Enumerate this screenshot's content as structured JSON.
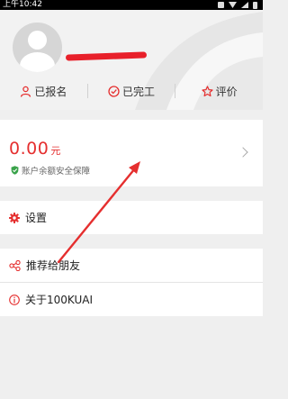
{
  "status_bar": {
    "time": "上午10:42"
  },
  "profile": {
    "avatar_icon": "default-avatar-icon"
  },
  "order_tabs": [
    {
      "label": "已报名",
      "icon": "person-icon"
    },
    {
      "label": "已完工",
      "icon": "check-circle-icon"
    },
    {
      "label": "评价",
      "icon": "star-icon"
    }
  ],
  "balance": {
    "amount": "0.00",
    "unit": "元",
    "safety_text": "账户余额安全保障",
    "safety_icon": "shield-check-icon"
  },
  "menu": {
    "settings": {
      "label": "设置",
      "icon": "gear-icon"
    },
    "recommend": {
      "label": "推荐给朋友",
      "icon": "share-icon"
    },
    "about": {
      "label": "关于100KUAI",
      "icon": "info-icon"
    }
  },
  "colors": {
    "accent": "#e52f2f",
    "shield": "#3aa34a",
    "background": "#efefef"
  }
}
